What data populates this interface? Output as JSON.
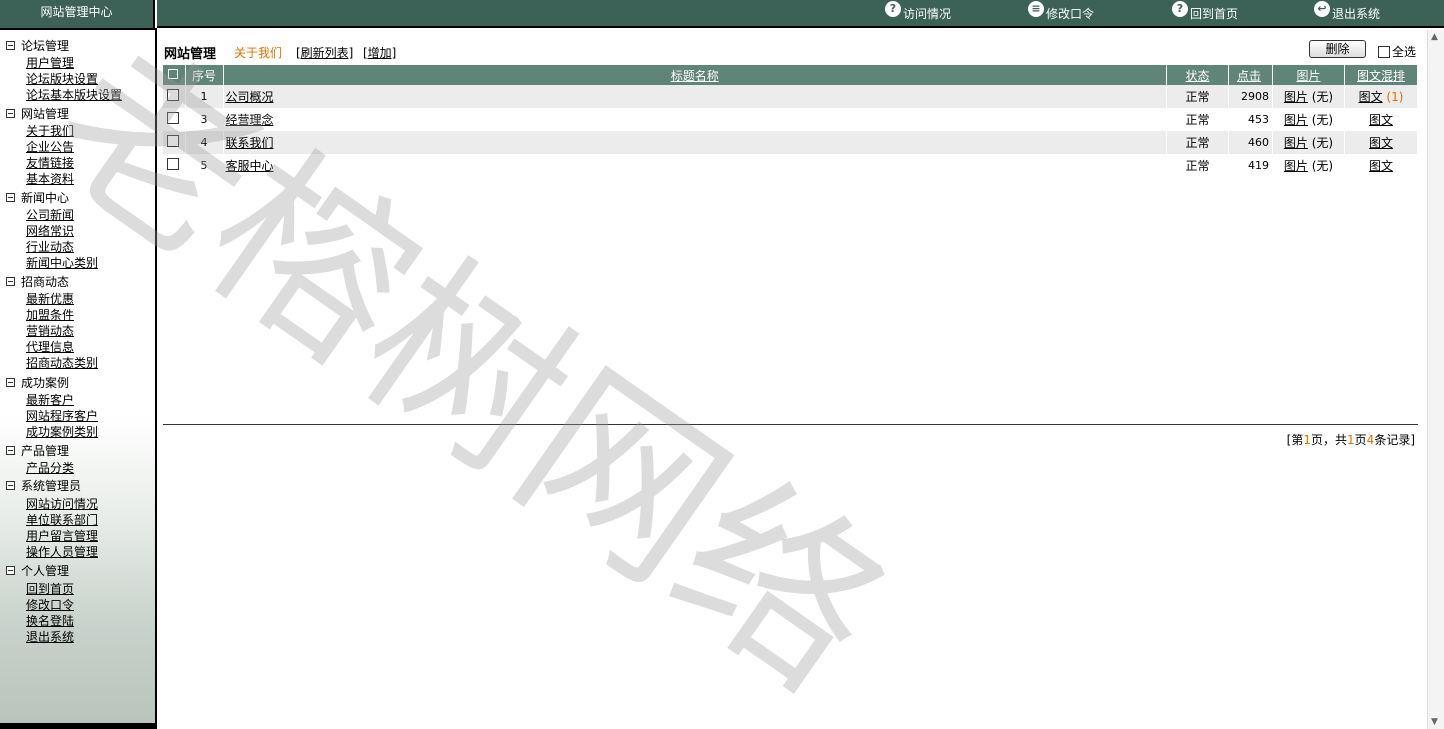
{
  "header": {
    "site_title": "网站管理中心",
    "links": [
      {
        "label": "访问情况",
        "icon": "visit-icon"
      },
      {
        "label": "修改口令",
        "icon": "document-icon"
      },
      {
        "label": "回到首页",
        "icon": "home-icon"
      },
      {
        "label": "退出系统",
        "icon": "exit-icon"
      }
    ]
  },
  "sidebar": {
    "groups": [
      {
        "label": "论坛管理",
        "items": [
          "用户管理",
          "论坛版块设置",
          "论坛基本版块设置"
        ]
      },
      {
        "label": "网站管理",
        "items": [
          "关于我们",
          "企业公告",
          "友情链接",
          "基本资料"
        ]
      },
      {
        "label": "新闻中心",
        "items": [
          "公司新闻",
          "网络常识",
          "行业动态",
          "新闻中心类别"
        ]
      },
      {
        "label": "招商动态",
        "items": [
          "最新优惠",
          "加盟条件",
          "营销动态",
          "代理信息",
          "招商动态类别"
        ]
      },
      {
        "label": "成功案例",
        "items": [
          "最新客户",
          "网站程序客户",
          "成功案例类别"
        ]
      },
      {
        "label": "产品管理",
        "items": [
          "产品分类"
        ]
      },
      {
        "label": "系统管理员",
        "items": [
          "网站访问情况",
          "单位联系部门",
          "用户留言管理",
          "操作人员管理"
        ]
      },
      {
        "label": "个人管理",
        "items": [
          "回到首页",
          "修改口令",
          "换名登陆",
          "退出系统"
        ]
      }
    ]
  },
  "main": {
    "title": "网站管理",
    "about_link": "关于我们",
    "refresh_link": "[刷新列表]",
    "add_link": "[增加]",
    "delete_button": "删除",
    "select_all": "全选",
    "columns": [
      "序号",
      "标题名称",
      "状态",
      "点击",
      "图片",
      "图文混排"
    ],
    "rows": [
      {
        "no": "1",
        "title": "公司概况",
        "status": "正常",
        "clicks": "2908",
        "pic": "图片",
        "pic_note": "(无)",
        "mix": "图文",
        "mix_count": "(1)"
      },
      {
        "no": "3",
        "title": "经营理念",
        "status": "正常",
        "clicks": "453",
        "pic": "图片",
        "pic_note": "(无)",
        "mix": "图文",
        "mix_count": ""
      },
      {
        "no": "4",
        "title": "联系我们",
        "status": "正常",
        "clicks": "460",
        "pic": "图片",
        "pic_note": "(无)",
        "mix": "图文",
        "mix_count": ""
      },
      {
        "no": "5",
        "title": "客服中心",
        "status": "正常",
        "clicks": "419",
        "pic": "图片",
        "pic_note": "(无)",
        "mix": "图文",
        "mix_count": ""
      }
    ],
    "pager": {
      "prefix": "[第",
      "page": "1",
      "mid1": "页，共",
      "pages": "1",
      "mid2": "页",
      "records": "4",
      "suffix": "条记录]"
    }
  },
  "watermark": "老榕树网络"
}
